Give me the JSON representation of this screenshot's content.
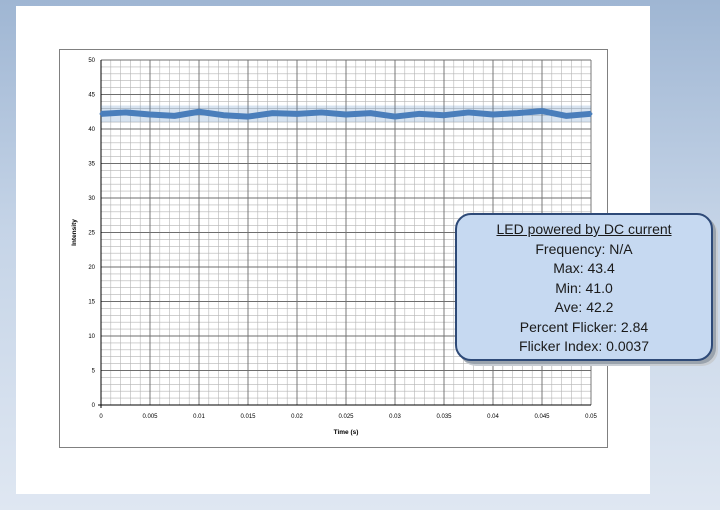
{
  "chart_data": {
    "type": "line",
    "title": "",
    "xlabel": "Time (s)",
    "ylabel": "Intensity",
    "xlim": [
      0,
      0.05
    ],
    "ylim": [
      0,
      50
    ],
    "x_ticks": [
      "0",
      "0.005",
      "0.01",
      "0.015",
      "0.02",
      "0.025",
      "0.03",
      "0.035",
      "0.04",
      "0.045",
      "0.05"
    ],
    "y_ticks": [
      "0",
      "5",
      "10",
      "15",
      "20",
      "25",
      "30",
      "35",
      "40",
      "45",
      "50"
    ],
    "grid": true,
    "series": [
      {
        "name": "",
        "color": "#4a7ebb",
        "x": [
          0,
          0.0025,
          0.005,
          0.0075,
          0.01,
          0.0125,
          0.015,
          0.0175,
          0.02,
          0.0225,
          0.025,
          0.0275,
          0.03,
          0.0325,
          0.035,
          0.0375,
          0.04,
          0.0425,
          0.045,
          0.0475,
          0.05
        ],
        "values": [
          42.2,
          42.4,
          42.1,
          41.9,
          42.5,
          42.0,
          41.8,
          42.3,
          42.2,
          42.4,
          42.1,
          42.3,
          41.8,
          42.2,
          42.0,
          42.4,
          42.1,
          42.3,
          42.6,
          41.9,
          42.2
        ],
        "band_min": 41.0,
        "band_max": 43.4
      }
    ]
  },
  "callout": {
    "title": "LED powered by DC current",
    "lines": [
      "Frequency: N/A",
      "Max: 43.4",
      "Min: 41.0",
      "Ave: 42.2",
      "Percent Flicker: 2.84",
      "Flicker Index: 0.0037"
    ]
  }
}
